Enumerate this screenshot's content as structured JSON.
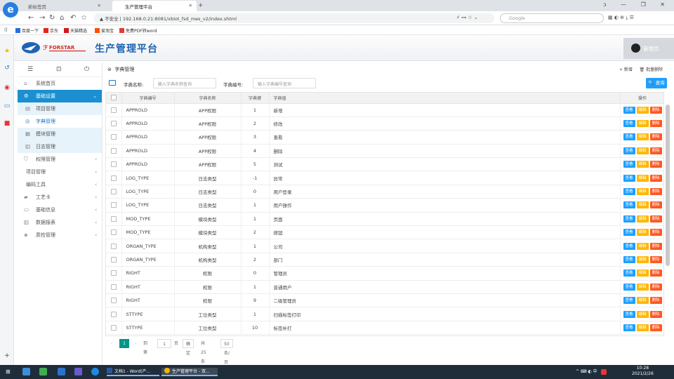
{
  "browser": {
    "tabs": [
      {
        "label": "新标签页"
      },
      {
        "label": "生产管理平台"
      }
    ],
    "new_tab": "+",
    "window_controls": "ᴐ  —  ❐  ✕",
    "url": "▲ 不安全 | 192.168.0.21:8081/xbiot_fsd_mes_v2/index.shtml",
    "search_placeholder": "Google",
    "bookmarks": [
      "百度一下",
      "京东",
      "天猫精选",
      "爱淘宝",
      "免费PDF转word"
    ]
  },
  "app": {
    "title": "生产管理平台",
    "logo_text": "FORSTAR",
    "user_name": "管理员"
  },
  "sidebar": {
    "items": [
      {
        "label": "系统首页",
        "icon": "home-icon",
        "glyph": "⌂",
        "state": "normal"
      },
      {
        "label": "基础设置",
        "icon": "gear-icon",
        "glyph": "⚙",
        "state": "open",
        "arrow": "⌄"
      },
      {
        "label": "项目管理",
        "icon": "list-icon",
        "glyph": "▤",
        "state": "sub"
      },
      {
        "label": "字典管理",
        "icon": "dict-icon",
        "glyph": "◎",
        "state": "sub-selected"
      },
      {
        "label": "模块管理",
        "icon": "module-icon",
        "glyph": "▦",
        "state": "sub"
      },
      {
        "label": "日志管理",
        "icon": "log-icon",
        "glyph": "▥",
        "state": "sub"
      },
      {
        "label": "权限管理",
        "icon": "shield-icon",
        "glyph": "⛉",
        "state": "normal",
        "arrow": "‹"
      },
      {
        "label": "项目管理",
        "icon": "",
        "glyph": "",
        "state": "plain",
        "arrow": "‹"
      },
      {
        "label": "编码工具",
        "icon": "",
        "glyph": "",
        "state": "plain",
        "arrow": "‹"
      },
      {
        "label": "工艺卡",
        "icon": "card-icon",
        "glyph": "▰",
        "state": "normal",
        "arrow": "‹"
      },
      {
        "label": "基础信息",
        "icon": "monitor-icon",
        "glyph": "▭",
        "state": "normal",
        "arrow": "‹"
      },
      {
        "label": "数据报表",
        "icon": "report-icon",
        "glyph": "▥",
        "state": "normal",
        "arrow": "‹"
      },
      {
        "label": "质检管理",
        "icon": "cap-icon",
        "glyph": "◈",
        "state": "normal",
        "arrow": "‹"
      }
    ]
  },
  "main": {
    "breadcrumb": "字典管理",
    "add_label": "新增",
    "batch_delete_label": "批量删除",
    "filter": {
      "name_label": "字典名称:",
      "name_placeholder": "输入字典名称查询",
      "code_label": "字典编号:",
      "code_placeholder": "输入字典编号查询",
      "query_label": "查询"
    },
    "columns": [
      "字典编号",
      "字典名称",
      "字典键",
      "字典值",
      "操作"
    ],
    "action_labels": {
      "view": "查看",
      "edit": "编辑",
      "delete": "删除"
    },
    "rows": [
      [
        "APPROLD",
        "APP权限",
        "1",
        "新增"
      ],
      [
        "APPROLD",
        "APP权限",
        "2",
        "修改"
      ],
      [
        "APPROLD",
        "APP权限",
        "3",
        "查看"
      ],
      [
        "APPROLD",
        "APP权限",
        "4",
        "删除"
      ],
      [
        "APPROLD",
        "APP权限",
        "5",
        "测试"
      ],
      [
        "LOG_TYPE",
        "日志类型",
        "-1",
        "异常"
      ],
      [
        "LOG_TYPE",
        "日志类型",
        "0",
        "用户登录"
      ],
      [
        "LOG_TYPE",
        "日志类型",
        "1",
        "用户操作"
      ],
      [
        "MOD_TYPE",
        "模块类型",
        "1",
        "页面"
      ],
      [
        "MOD_TYPE",
        "模块类型",
        "2",
        "按钮"
      ],
      [
        "ORGAN_TYPE",
        "机构类型",
        "1",
        "公司"
      ],
      [
        "ORGAN_TYPE",
        "机构类型",
        "2",
        "部门"
      ],
      [
        "RIGHT",
        "权限",
        "0",
        "管理员"
      ],
      [
        "RIGHT",
        "权限",
        "1",
        "普通用户"
      ],
      [
        "RIGHT",
        "权限",
        "9",
        "二级管理员"
      ],
      [
        "STTYPE",
        "工位类型",
        "1",
        "扫描标签打印"
      ],
      [
        "STTYPE",
        "工位类型",
        "10",
        "标签补打"
      ]
    ],
    "pager": {
      "current_page": "1",
      "goto_label": "到第",
      "goto_value": "1",
      "page_unit": "页",
      "confirm_label": "确定",
      "total_label": "共 25 条",
      "page_size_label": "50 条/页"
    }
  },
  "taskbar": {
    "word_label": "文档1 - Word(产...",
    "browser_label": "生产管理平台 - 双...",
    "tray": "^ ⌨ ◐ 中",
    "time": "10:28",
    "date": "2021/2/26"
  },
  "colors": {
    "accent": "#1b8fcf",
    "title_blue": "#1f63b5",
    "view_btn": "#1e9fff",
    "edit_btn": "#ffb800",
    "delete_btn": "#ff5722",
    "pager_active": "#009688"
  }
}
